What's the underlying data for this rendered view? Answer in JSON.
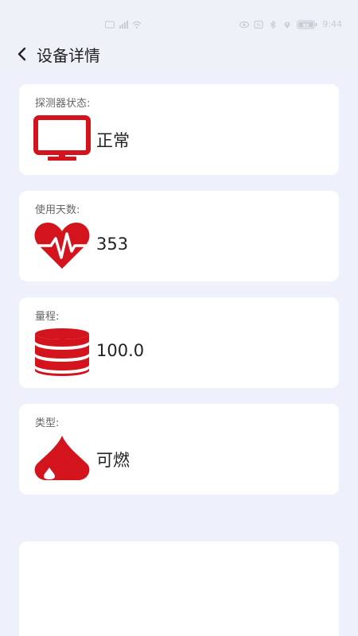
{
  "status_bar": {
    "time": "9:44",
    "battery": "88",
    "icons": [
      "hd-icon",
      "signal-icon",
      "wifi-icon",
      "eye-icon",
      "nfc-icon",
      "bluetooth-icon",
      "location-icon",
      "battery-icon"
    ]
  },
  "header": {
    "title": "设备详情",
    "back_icon": "chevron-left-icon"
  },
  "cards": [
    {
      "label": "探测器状态:",
      "value": "正常",
      "icon": "monitor-icon"
    },
    {
      "label": "使用天数:",
      "value": "353",
      "icon": "heartbeat-icon"
    },
    {
      "label": "量程:",
      "value": "100.0",
      "icon": "database-icon"
    },
    {
      "label": "类型:",
      "value": "可燃",
      "icon": "flame-drop-icon"
    }
  ],
  "colors": {
    "accent": "#d4141c",
    "background": "#eef1fb",
    "card": "#ffffff",
    "text": "#222222",
    "label": "#666666"
  }
}
